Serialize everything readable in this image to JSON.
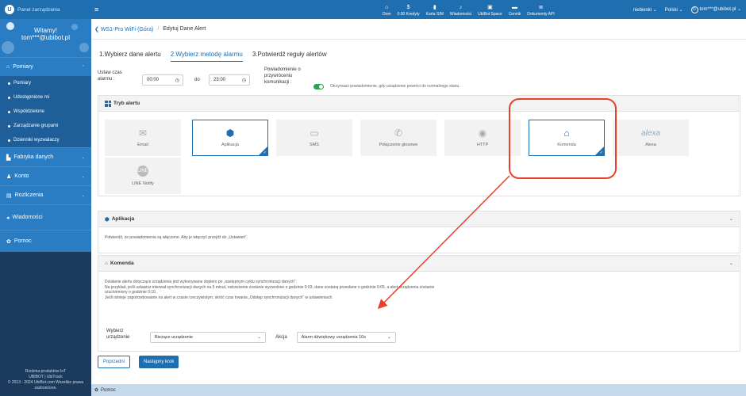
{
  "topbar": {
    "brand": "Panel zarządzania",
    "nav": [
      {
        "icon": "home-icon",
        "glyph": "⌂",
        "label": "Dom"
      },
      {
        "icon": "credits-icon",
        "glyph": "$",
        "label": "0.00 Kredyty"
      },
      {
        "icon": "sim-card-icon",
        "glyph": "▮",
        "label": "Karta SIM"
      },
      {
        "icon": "bell-icon",
        "glyph": "♪",
        "label": "Wiadomości"
      },
      {
        "icon": "space-icon",
        "glyph": "▣",
        "label": "UbiBot Space"
      },
      {
        "icon": "price-icon",
        "glyph": "▬",
        "label": "Cennik"
      },
      {
        "icon": "api-doc-icon",
        "glyph": "≣",
        "label": "Dokumenty API"
      }
    ],
    "theme": "niebieski",
    "language": "Polski",
    "user": "tom***@ubibot.pl"
  },
  "sidebar": {
    "welcome": "Witamy!",
    "user": "tom***@ubibot.pl",
    "sections": {
      "pomiary": "Pomiary",
      "fabryka": "Fabryka danych",
      "konto": "Konto",
      "rozliczenia": "Rozliczenia",
      "wiadomosci": "Wiadomości",
      "pomoc": "Pomoc"
    },
    "sub": [
      "Pomiary",
      "Udostępnione mi",
      "Współdzielone",
      "Zarządzanie grupami",
      "Dzienniki wyzwalaczy"
    ],
    "footer_line1": "Rodzina produktów IoT",
    "footer_brands": "UBIBOT | UbiTrack",
    "footer_line2": "© 2013 - 2024 UbiBot.com Wszelkie prawa",
    "footer_line3": "zastrzeżone."
  },
  "breadcrumb": {
    "back": "WS1-Pro WiFi (Góra)",
    "current": "Edytuj Dane Alert"
  },
  "steps": [
    "1.Wybierz dane alertu",
    "2.Wybierz metodę alarmu",
    "3.Potwierdź reguły alertów"
  ],
  "schedule": {
    "label1": "Ustaw czas",
    "label2": "alarmu :",
    "from": "00:00",
    "to_label": "do",
    "to": "23:00",
    "notif_l1": "Powiadomienie o",
    "notif_l2": "przywróceniu",
    "notif_l3": "komunikacji :",
    "notif_desc": "Otrzymasz powiadomienie, gdy urządzenie powróci do normalnego stanu."
  },
  "modes_panel": {
    "title": "Tryb alertu",
    "modes": [
      "Email",
      "Aplikacja",
      "SMS",
      "Połączenie głosowe",
      "HTTP",
      "Komenda",
      "Alexa",
      "LINE Notify"
    ],
    "alexa_logo": "alexa",
    "line_logo": "LINE"
  },
  "app_panel": {
    "title": "Aplikacja",
    "text": "Potwierdź, że powiadomienia są włączone. Aby je włączyć przejdź do „Ustawień”."
  },
  "cmd_panel": {
    "title": "Komenda",
    "p1": "Działanie alertu dotyczące urządzenia jest wykonywane dopiero po „następnym cyklu synchronizacji danych”.",
    "p2": "Na przykład, jeśli ustawisz interwał synchronizacji danych na 5 minut, ostrzeżenie zostanie wyzwolone o godzinie 0:03, dane zostaną przesłane o godzinie 0:05, a alert urządzenia zostanie",
    "p3": "uruchomiony o godzinie 0:10.",
    "p4": "Jeśli istnieje zapotrzebowanie na alert w czasie rzeczywistym, skróć czas trwania „Odstęp synchronizacji danych” w ustawieniach.",
    "device_label1": "Wybierz",
    "device_label2": "urządzenie",
    "device_value": "Bieżące urządzenie",
    "action_label": "Akcja",
    "action_value": "Alarm dźwiękowy urządzenia 10s"
  },
  "buttons": {
    "prev": "Poprzedni",
    "next": "Następny krok"
  },
  "footer": {
    "label": "Pomoc"
  },
  "colors": {
    "primary": "#1f6eb0",
    "sidebar": "#2a7dc3",
    "annotation": "#e8412a",
    "toggle_on": "#2ea14b"
  }
}
